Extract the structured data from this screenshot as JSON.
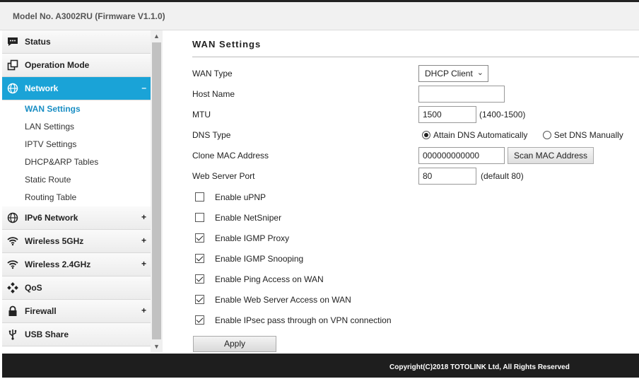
{
  "header": {
    "model": "Model No. A3002RU (Firmware V1.1.0)"
  },
  "sidebar": {
    "items": [
      {
        "label": "Status",
        "icon": "chat-icon",
        "sign": ""
      },
      {
        "label": "Operation Mode",
        "icon": "windows-icon",
        "sign": ""
      },
      {
        "label": "Network",
        "icon": "globe-icon",
        "sign": "–",
        "active": true
      },
      {
        "label": "IPv6 Network",
        "icon": "globe-icon",
        "sign": "+"
      },
      {
        "label": "Wireless 5GHz",
        "icon": "wifi-icon",
        "sign": "+"
      },
      {
        "label": "Wireless 2.4GHz",
        "icon": "wifi-icon",
        "sign": "+"
      },
      {
        "label": "QoS",
        "icon": "qos-icon",
        "sign": ""
      },
      {
        "label": "Firewall",
        "icon": "lock-icon",
        "sign": "+"
      },
      {
        "label": "USB Share",
        "icon": "usb-icon",
        "sign": ""
      }
    ],
    "network_sub": [
      "WAN Settings",
      "LAN Settings",
      "IPTV Settings",
      "DHCP&ARP Tables",
      "Static Route",
      "Routing Table"
    ]
  },
  "page": {
    "title": "WAN Settings"
  },
  "form": {
    "wan_type": {
      "label": "WAN Type",
      "value": "DHCP Client"
    },
    "host_name": {
      "label": "Host Name",
      "value": ""
    },
    "mtu": {
      "label": "MTU",
      "value": "1500",
      "hint": "(1400-1500)"
    },
    "dns_type": {
      "label": "DNS Type",
      "option1": "Attain DNS Automatically",
      "option2": "Set DNS Manually",
      "selected": "option1"
    },
    "clone_mac": {
      "label": "Clone MAC Address",
      "value": "000000000000",
      "button": "Scan MAC Address"
    },
    "web_port": {
      "label": "Web Server Port",
      "value": "80",
      "hint": "(default 80)"
    },
    "checkboxes": [
      {
        "label": "Enable uPNP",
        "checked": false
      },
      {
        "label": "Enable NetSniper",
        "checked": false
      },
      {
        "label": "Enable IGMP Proxy",
        "checked": true
      },
      {
        "label": "Enable IGMP Snooping",
        "checked": true
      },
      {
        "label": "Enable Ping Access on WAN",
        "checked": true
      },
      {
        "label": "Enable Web Server Access on WAN",
        "checked": true
      },
      {
        "label": "Enable IPsec pass through on VPN connection",
        "checked": true
      }
    ],
    "apply_label": "Apply"
  },
  "footer": {
    "copyright": "Copyright(C)2018 TOTOLINK Ltd, All Rights Reserved"
  },
  "colors": {
    "accent": "#1aa3d7",
    "footer_bg": "#1e1e1e"
  }
}
